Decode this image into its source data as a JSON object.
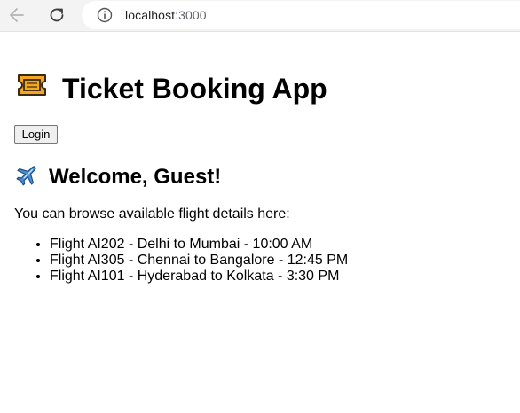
{
  "browser": {
    "url_host": "localhost",
    "url_port": ":3000"
  },
  "app": {
    "title": "Ticket Booking App",
    "login_label": "Login"
  },
  "welcome": {
    "heading": "Welcome, Guest!",
    "intro": "You can browse available flight details here:"
  },
  "flights": [
    "Flight AI202 - Delhi to Mumbai - 10:00 AM",
    "Flight AI305 - Chennai to Bangalore - 12:45 PM",
    "Flight AI101 - Hyderabad to Kolkata - 3:30 PM"
  ],
  "icons": {
    "title": "ticket-icon",
    "welcome": "airplane-icon"
  }
}
